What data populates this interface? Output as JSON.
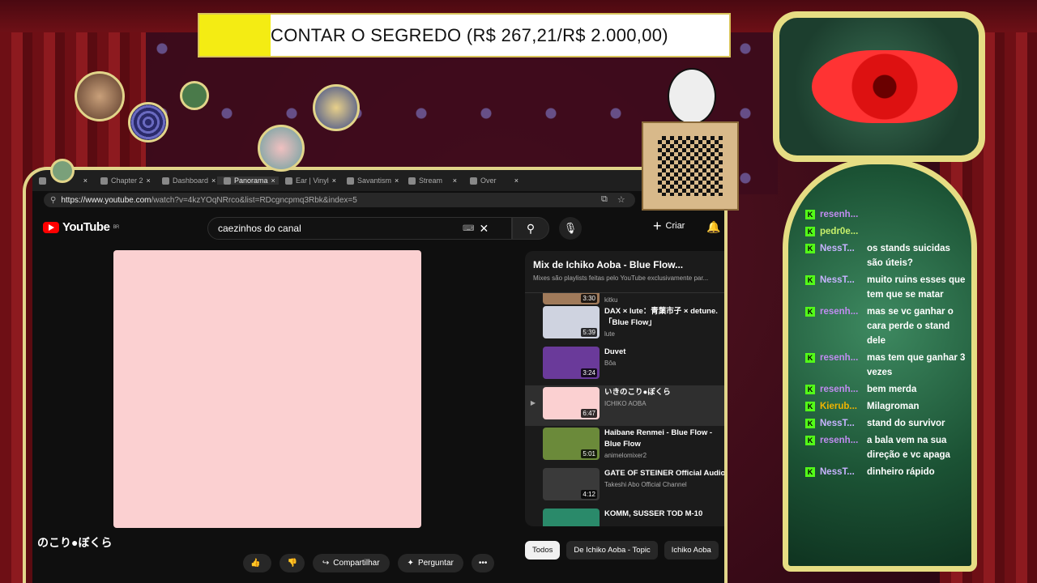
{
  "goal": {
    "text": "CONTAR O SEGREDO (R$ 267,21/R$ 2.000,00)",
    "progress": 0.134
  },
  "browser": {
    "tabs": [
      {
        "label": "",
        "active": false
      },
      {
        "label": "Chapter 2",
        "active": false
      },
      {
        "label": "Dashboard",
        "active": false
      },
      {
        "label": "Panorama",
        "active": true
      },
      {
        "label": "Ear | Vinyl",
        "active": false
      },
      {
        "label": "Savantism",
        "active": false
      },
      {
        "label": "Stream",
        "active": false
      },
      {
        "label": "Over",
        "active": false
      }
    ],
    "url_host": "https://www.youtube.com",
    "url_rest": "/watch?v=4kzYOqNRrco&list=RDcgncpmq3Rbk&index=5"
  },
  "youtube": {
    "logo": "YouTube",
    "region": "BR",
    "search_value": "caezinhos do canal",
    "create_label": "Criar",
    "video_title": "のこり●ぼくら",
    "share_label": "Compartilhar",
    "ask_label": "Perguntar",
    "likes": "",
    "playlist": {
      "title": "Mix de Ichiko Aoba - Blue Flow...",
      "subtitle": "Mixes são playlists feitas pelo YouTube exclusivamente par...",
      "partial": {
        "duration": "3:30",
        "channel": "kitku"
      },
      "items": [
        {
          "title": "DAX × lute：青葉市子 × detune.「Blue Flow」",
          "channel": "lute",
          "duration": "5:39",
          "color": "#cfd3e0",
          "active": false
        },
        {
          "title": "Duvet",
          "channel": "Bôa",
          "duration": "3:24",
          "color": "#6a3a9a",
          "active": false
        },
        {
          "title": "いきのこり●ぼくら",
          "channel": "ICHIKO AOBA",
          "duration": "6:47",
          "color": "#fbd0d1",
          "active": true
        },
        {
          "title": "Haibane Renmei - Blue Flow - Blue Flow",
          "channel": "animelomixer2",
          "duration": "5:01",
          "color": "#6b8a3a",
          "active": false
        },
        {
          "title": "GATE OF STEINER Official Audio",
          "channel": "Takeshi Abo Official Channel",
          "duration": "4:12",
          "color": "#3a3a3a",
          "active": false
        },
        {
          "title": "KOMM, SUSSER TOD M-10",
          "channel": "",
          "duration": "",
          "color": "#2a8a6a",
          "active": false
        }
      ]
    },
    "chips": [
      {
        "label": "Todos",
        "selected": true
      },
      {
        "label": "De Ichiko Aoba - Topic",
        "selected": false
      },
      {
        "label": "Ichiko Aoba",
        "selected": false
      }
    ]
  },
  "chat": [
    {
      "user": "resenh...",
      "text": "",
      "color": "#c08cf0"
    },
    {
      "user": "pedr0e...",
      "text": "",
      "color": "#c7f06a"
    },
    {
      "user": "NessT...",
      "text": "os stands suicidas são úteis?",
      "color": "#c7b3ff"
    },
    {
      "user": "NessT...",
      "text": "muito ruins esses que tem que se matar",
      "color": "#c7b3ff"
    },
    {
      "user": "resenh...",
      "text": "mas se vc ganhar o cara perde o stand dele",
      "color": "#c08cf0"
    },
    {
      "user": "resenh...",
      "text": "mas tem que ganhar 3 vezes",
      "color": "#c08cf0"
    },
    {
      "user": "resenh...",
      "text": "bem merda",
      "color": "#c08cf0"
    },
    {
      "user": "Kierub...",
      "text": "Milagroman",
      "color": "#f0b400"
    },
    {
      "user": "NessT...",
      "text": "stand do survivor",
      "color": "#c7b3ff"
    },
    {
      "user": "resenh...",
      "text": "a bala vem na sua direção e vc apaga",
      "color": "#c08cf0"
    },
    {
      "user": "NessT...",
      "text": "dinheiro rápido",
      "color": "#c7b3ff"
    }
  ]
}
